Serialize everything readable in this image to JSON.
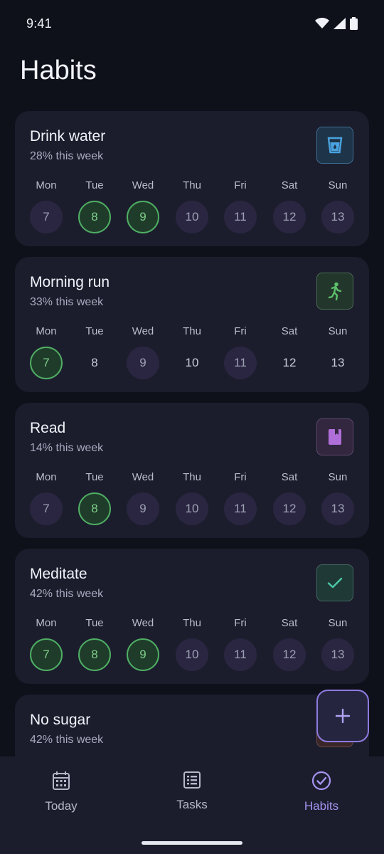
{
  "status_bar": {
    "time": "9:41"
  },
  "page": {
    "title": "Habits"
  },
  "habits": [
    {
      "name": "Drink water",
      "progress": "28% this week",
      "icon": "cup-icon",
      "accent": "#4aa3e0",
      "days": [
        {
          "label": "Mon",
          "date": "7",
          "state": "pending"
        },
        {
          "label": "Tue",
          "date": "8",
          "state": "done"
        },
        {
          "label": "Wed",
          "date": "9",
          "state": "done"
        },
        {
          "label": "Thu",
          "date": "10",
          "state": "pending"
        },
        {
          "label": "Fri",
          "date": "11",
          "state": "pending"
        },
        {
          "label": "Sat",
          "date": "12",
          "state": "pending"
        },
        {
          "label": "Sun",
          "date": "13",
          "state": "pending"
        }
      ]
    },
    {
      "name": "Morning run",
      "progress": "33% this week",
      "icon": "running-icon",
      "accent": "#5cc06a",
      "days": [
        {
          "label": "Mon",
          "date": "7",
          "state": "done"
        },
        {
          "label": "Tue",
          "date": "8",
          "state": "empty"
        },
        {
          "label": "Wed",
          "date": "9",
          "state": "pending"
        },
        {
          "label": "Thu",
          "date": "10",
          "state": "empty"
        },
        {
          "label": "Fri",
          "date": "11",
          "state": "pending"
        },
        {
          "label": "Sat",
          "date": "12",
          "state": "empty"
        },
        {
          "label": "Sun",
          "date": "13",
          "state": "empty"
        }
      ]
    },
    {
      "name": "Read",
      "progress": "14% this week",
      "icon": "book-icon",
      "accent": "#b06fd8",
      "days": [
        {
          "label": "Mon",
          "date": "7",
          "state": "pending"
        },
        {
          "label": "Tue",
          "date": "8",
          "state": "done"
        },
        {
          "label": "Wed",
          "date": "9",
          "state": "pending"
        },
        {
          "label": "Thu",
          "date": "10",
          "state": "pending"
        },
        {
          "label": "Fri",
          "date": "11",
          "state": "pending"
        },
        {
          "label": "Sat",
          "date": "12",
          "state": "pending"
        },
        {
          "label": "Sun",
          "date": "13",
          "state": "pending"
        }
      ]
    },
    {
      "name": "Meditate",
      "progress": "42% this week",
      "icon": "check-icon",
      "accent": "#4cc9a8",
      "days": [
        {
          "label": "Mon",
          "date": "7",
          "state": "done"
        },
        {
          "label": "Tue",
          "date": "8",
          "state": "done"
        },
        {
          "label": "Wed",
          "date": "9",
          "state": "done"
        },
        {
          "label": "Thu",
          "date": "10",
          "state": "pending"
        },
        {
          "label": "Fri",
          "date": "11",
          "state": "pending"
        },
        {
          "label": "Sat",
          "date": "12",
          "state": "pending"
        },
        {
          "label": "Sun",
          "date": "13",
          "state": "pending"
        }
      ]
    },
    {
      "name": "No sugar",
      "progress": "42% this week",
      "icon": "habit-icon",
      "accent": "#d07a5a",
      "days": []
    }
  ],
  "fab": {
    "icon": "plus-icon"
  },
  "bottom_nav": [
    {
      "label": "Today",
      "icon": "calendar-icon",
      "active": false
    },
    {
      "label": "Tasks",
      "icon": "list-icon",
      "active": false
    },
    {
      "label": "Habits",
      "icon": "check-circle-icon",
      "active": true
    }
  ],
  "colors": {
    "background": "#0f111a",
    "card": "#1b1d2d",
    "done_fill": "#1f3b2a",
    "done_border": "#4fae63",
    "accent": "#a594f0"
  }
}
